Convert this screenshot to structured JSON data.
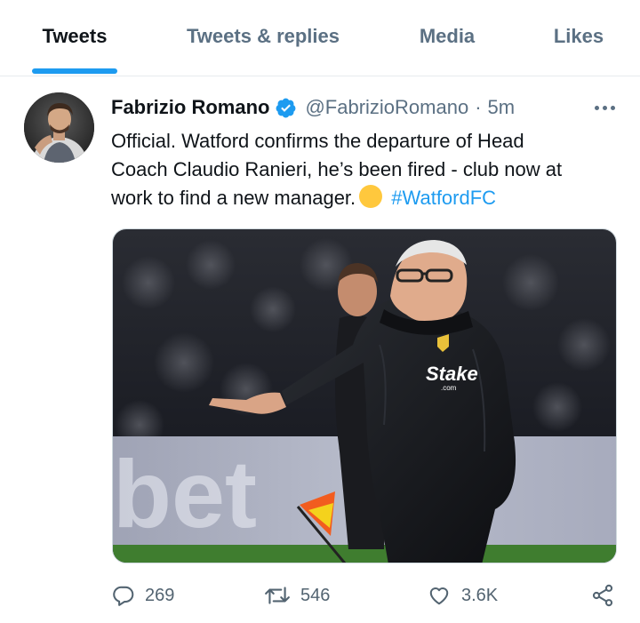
{
  "tabs": [
    {
      "label": "Tweets",
      "active": true
    },
    {
      "label": "Tweets & replies",
      "active": false
    },
    {
      "label": "Media",
      "active": false
    },
    {
      "label": "Likes",
      "active": false
    }
  ],
  "tweet": {
    "author": {
      "display_name": "Fabrizio Romano",
      "handle": "@FabrizioRomano",
      "verified": true
    },
    "separator": "·",
    "timestamp": "5m",
    "text_lines": [
      "Official. Watford confirms the departure of Head",
      "Coach Claudio Ranieri, he’s been fired - club now at",
      "work to find a new manager."
    ],
    "emoji": "yellow-circle",
    "hashtag": "#WatfordFC",
    "media": {
      "jacket_text": "Stake",
      "jacket_subtext": ".com",
      "board_text": "bet"
    },
    "actions": {
      "replies": "269",
      "retweets": "546",
      "likes": "3.6K"
    }
  },
  "colors": {
    "accent": "#1d9bf0",
    "muted": "#5b7083",
    "text": "#0f1419"
  },
  "icons": [
    "verified-badge-icon",
    "more-icon",
    "reply-icon",
    "retweet-icon",
    "like-icon",
    "share-icon"
  ]
}
